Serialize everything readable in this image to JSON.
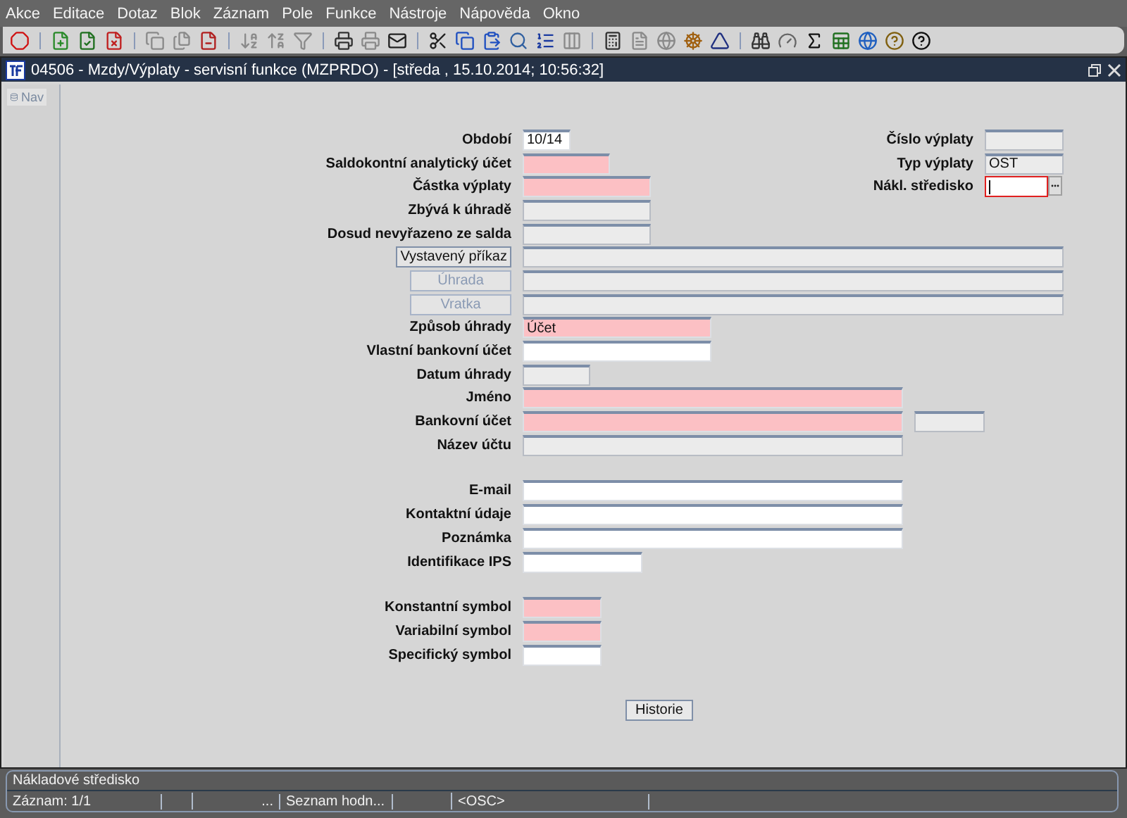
{
  "menu": [
    "Akce",
    "Editace",
    "Dotaz",
    "Blok",
    "Záznam",
    "Pole",
    "Funkce",
    "Nástroje",
    "Nápověda",
    "Okno"
  ],
  "window": {
    "title": "04506 - Mzdy/Výplaty - servisní funkce (MZPRDO) - [středa , 15.10.2014; 10:56:32]"
  },
  "nav": {
    "label": "Nav"
  },
  "form": {
    "sections": [
      {
        "rows": [
          {
            "kind": "field",
            "label": "Období",
            "field": {
              "required": false,
              "readonly": false,
              "value": "10/14"
            },
            "side": {
              "label": "Číslo výplaty",
              "field": {
                "required": false,
                "readonly": true
              }
            }
          },
          {
            "kind": "field",
            "label": "Saldokontní analytický účet",
            "field": {
              "required": true,
              "readonly": false
            },
            "side": {
              "label": "Typ výplaty",
              "field": {
                "required": false,
                "readonly": true,
                "value": "OST"
              }
            }
          },
          {
            "kind": "field",
            "label": "Částka výplaty",
            "field": {
              "required": true,
              "readonly": false
            },
            "side": {
              "label": "Nákl. středisko",
              "field": {
                "required": false,
                "readonly": false,
                "focused": true,
                "lookup": true
              }
            }
          },
          {
            "kind": "field",
            "label": "Zbývá k úhradě",
            "field": {
              "required": false,
              "readonly": true
            }
          },
          {
            "kind": "field",
            "label": "Dosud nevyřazeno ze salda",
            "field": {
              "required": false,
              "readonly": true
            }
          },
          {
            "kind": "button",
            "button": {
              "label": "Vystavený příkaz",
              "disabled": false
            },
            "field": {
              "required": false,
              "readonly": true
            }
          },
          {
            "kind": "button",
            "button": {
              "label": "Úhrada",
              "disabled": true
            },
            "field": {
              "required": false,
              "readonly": true
            }
          },
          {
            "kind": "button",
            "button": {
              "label": "Vratka",
              "disabled": true
            },
            "field": {
              "required": false,
              "readonly": true
            }
          },
          {
            "kind": "field",
            "label": "Způsob úhrady",
            "field": {
              "required": true,
              "readonly": false,
              "value": "Účet"
            }
          },
          {
            "kind": "field",
            "label": "Vlastní bankovní účet",
            "field": {
              "required": false,
              "readonly": false
            }
          },
          {
            "kind": "field",
            "label": "Datum úhrady",
            "field": {
              "required": false,
              "readonly": true
            }
          },
          {
            "kind": "field",
            "label": "Jméno",
            "field": {
              "required": true,
              "readonly": false
            }
          },
          {
            "kind": "field",
            "label": "Bankovní účet",
            "field": {
              "required": true,
              "readonly": false
            },
            "extra": {
              "required": false,
              "readonly": true
            }
          },
          {
            "kind": "field",
            "label": "Název účtu",
            "field": {
              "required": false,
              "readonly": true
            }
          }
        ]
      },
      {
        "rows": [
          {
            "kind": "field",
            "label": "E-mail",
            "field": {
              "required": false,
              "readonly": false
            }
          },
          {
            "kind": "field",
            "label": "Kontaktní údaje",
            "field": {
              "required": false,
              "readonly": false
            }
          },
          {
            "kind": "field",
            "label": "Poznámka",
            "field": {
              "required": false,
              "readonly": false
            }
          },
          {
            "kind": "field",
            "label": "Identifikace IPS",
            "field": {
              "required": false,
              "readonly": false
            }
          }
        ]
      },
      {
        "rows": [
          {
            "kind": "field",
            "label": "Konstantní symbol",
            "field": {
              "required": true,
              "readonly": false
            }
          },
          {
            "kind": "field",
            "label": "Variabilní symbol",
            "field": {
              "required": true,
              "readonly": false
            }
          },
          {
            "kind": "field",
            "label": "Specifický symbol",
            "field": {
              "required": false,
              "readonly": false
            }
          }
        ]
      }
    ],
    "history_button": "Historie"
  },
  "status_bar": {
    "message": "Nákladové středisko",
    "segments": [
      "Záznam: 1/1",
      "...",
      "Seznam hodn...",
      "<OSC>"
    ]
  }
}
